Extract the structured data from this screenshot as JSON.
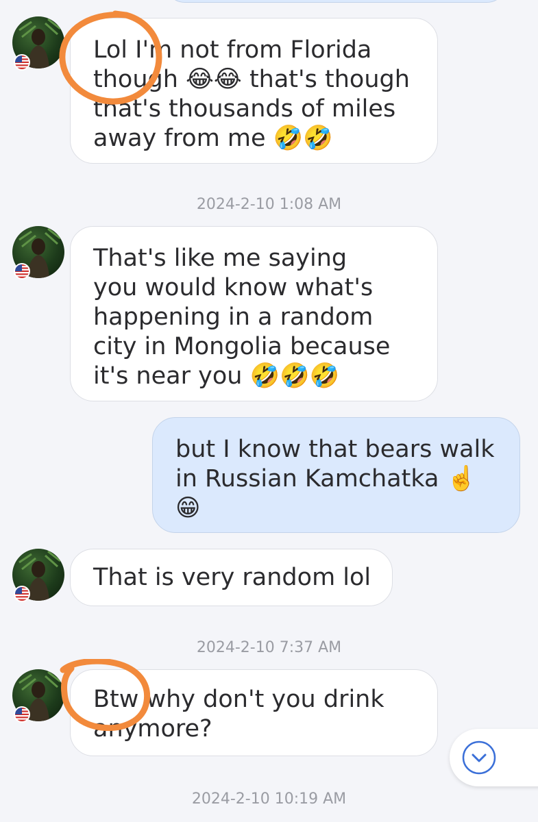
{
  "accent_color": "#f28a3c",
  "messages": [
    {
      "direction": "incoming",
      "text": "Lol I'm not from Florida\nthough 😂😂 that's though\nthat's thousands of miles\naway from me 🤣🤣"
    },
    {
      "direction": "incoming",
      "text": "That's like me saying\nyou would know what's\nhappening in a random\ncity in Mongolia because\nit's near you 🤣🤣🤣"
    },
    {
      "direction": "outgoing",
      "text": "but I know that bears walk\nin Russian  Kamchatka ☝️\n😁"
    },
    {
      "direction": "incoming",
      "text": "That is very random lol"
    },
    {
      "direction": "incoming",
      "text": "Btw why don't you drink\nanymore?"
    }
  ],
  "timestamps": [
    "2024-2-10 1:08 AM",
    "2024-2-10 7:37 AM",
    "2024-2-10 10:19 AM"
  ],
  "contact": {
    "avatar_icon": "profile-photo",
    "country_flag_icon": "us-flag-icon"
  },
  "scroll_button": {
    "icon": "chevron-down-icon"
  }
}
